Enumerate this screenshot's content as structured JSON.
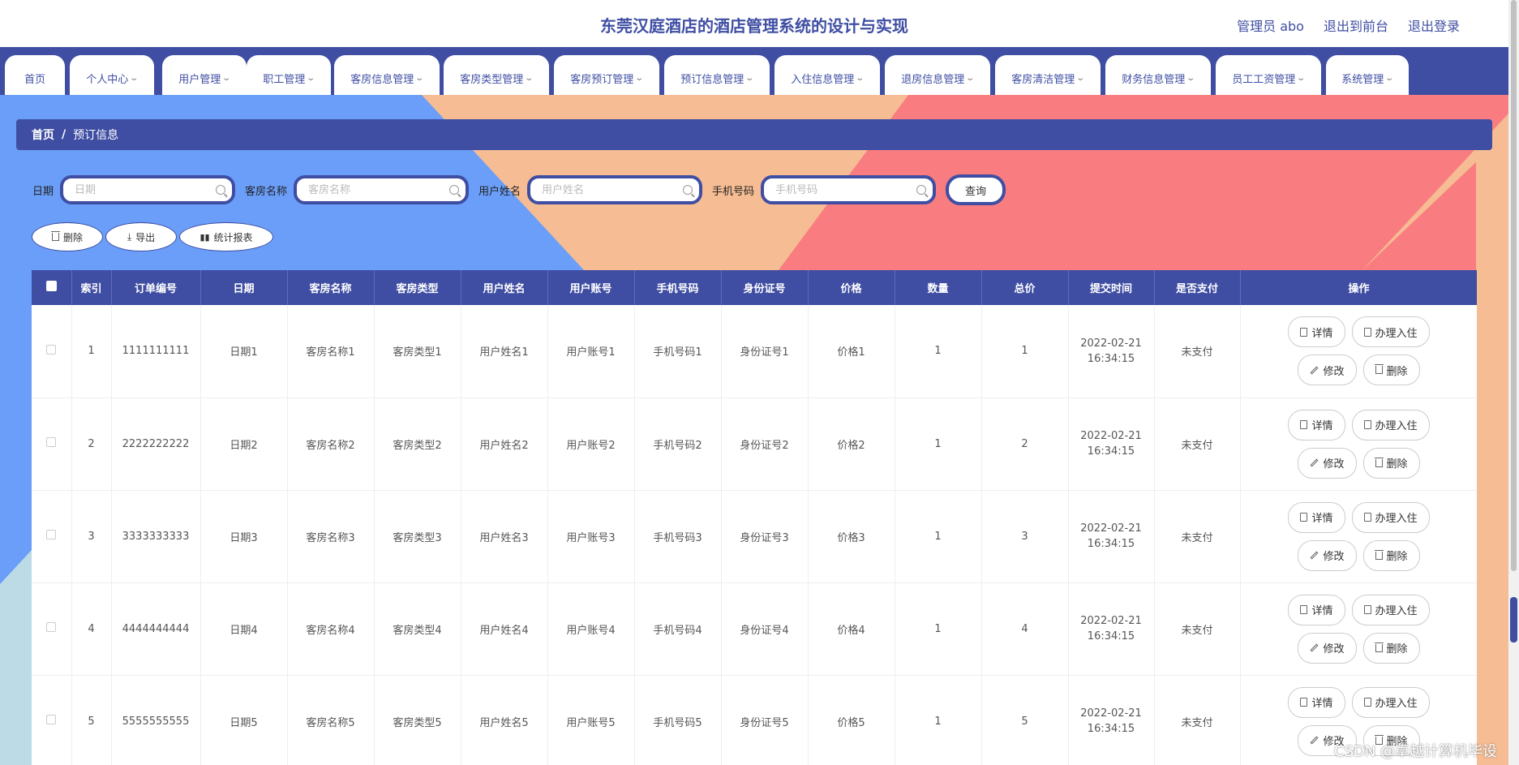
{
  "header": {
    "title": "东莞汉庭酒店的酒店管理系统的设计与实现",
    "admin_label": "管理员 abo",
    "to_front_label": "退出到前台",
    "logout_label": "退出登录"
  },
  "nav": {
    "items": [
      {
        "label": "首页",
        "has_dropdown": false
      },
      {
        "label": "个人中心",
        "has_dropdown": true
      },
      {
        "label": "用户管理",
        "has_dropdown": true
      },
      {
        "label": "职工管理",
        "has_dropdown": true
      },
      {
        "label": "客房信息管理",
        "has_dropdown": true
      },
      {
        "label": "客房类型管理",
        "has_dropdown": true
      },
      {
        "label": "客房预订管理",
        "has_dropdown": true
      },
      {
        "label": "预订信息管理",
        "has_dropdown": true
      },
      {
        "label": "入住信息管理",
        "has_dropdown": true
      },
      {
        "label": "退房信息管理",
        "has_dropdown": true
      },
      {
        "label": "客房清洁管理",
        "has_dropdown": true
      },
      {
        "label": "财务信息管理",
        "has_dropdown": true
      },
      {
        "label": "员工工资管理",
        "has_dropdown": true
      },
      {
        "label": "系统管理",
        "has_dropdown": true
      }
    ]
  },
  "breadcrumb": {
    "home": "首页",
    "separator": "/",
    "current": "预订信息"
  },
  "search": {
    "date_label": "日期",
    "date_placeholder": "日期",
    "room_name_label": "客房名称",
    "room_name_placeholder": "客房名称",
    "user_name_label": "用户姓名",
    "user_name_placeholder": "用户姓名",
    "phone_label": "手机号码",
    "phone_placeholder": "手机号码",
    "query_label": "查询"
  },
  "actions": {
    "delete_label": "删除",
    "export_label": "导出",
    "report_label": "统计报表"
  },
  "table": {
    "columns": [
      "索引",
      "订单编号",
      "日期",
      "客房名称",
      "客房类型",
      "用户姓名",
      "用户账号",
      "手机号码",
      "身份证号",
      "价格",
      "数量",
      "总价",
      "提交时间",
      "是否支付",
      "操作"
    ],
    "rows": [
      {
        "index": "1",
        "order_no": "1111111111",
        "date": "日期1",
        "room_name": "客房名称1",
        "room_type": "客房类型1",
        "user_name": "用户姓名1",
        "user_account": "用户账号1",
        "phone": "手机号码1",
        "id_no": "身份证号1",
        "price": "价格1",
        "qty": "1",
        "total": "1",
        "submit_date": "2022-02-21",
        "submit_time": "16:34:15",
        "paid": "未支付"
      },
      {
        "index": "2",
        "order_no": "2222222222",
        "date": "日期2",
        "room_name": "客房名称2",
        "room_type": "客房类型2",
        "user_name": "用户姓名2",
        "user_account": "用户账号2",
        "phone": "手机号码2",
        "id_no": "身份证号2",
        "price": "价格2",
        "qty": "1",
        "total": "2",
        "submit_date": "2022-02-21",
        "submit_time": "16:34:15",
        "paid": "未支付"
      },
      {
        "index": "3",
        "order_no": "3333333333",
        "date": "日期3",
        "room_name": "客房名称3",
        "room_type": "客房类型3",
        "user_name": "用户姓名3",
        "user_account": "用户账号3",
        "phone": "手机号码3",
        "id_no": "身份证号3",
        "price": "价格3",
        "qty": "1",
        "total": "3",
        "submit_date": "2022-02-21",
        "submit_time": "16:34:15",
        "paid": "未支付"
      },
      {
        "index": "4",
        "order_no": "4444444444",
        "date": "日期4",
        "room_name": "客房名称4",
        "room_type": "客房类型4",
        "user_name": "用户姓名4",
        "user_account": "用户账号4",
        "phone": "手机号码4",
        "id_no": "身份证号4",
        "price": "价格4",
        "qty": "1",
        "total": "4",
        "submit_date": "2022-02-21",
        "submit_time": "16:34:15",
        "paid": "未支付"
      },
      {
        "index": "5",
        "order_no": "5555555555",
        "date": "日期5",
        "room_name": "客房名称5",
        "room_type": "客房类型5",
        "user_name": "用户姓名5",
        "user_account": "用户账号5",
        "phone": "手机号码5",
        "id_no": "身份证号5",
        "price": "价格5",
        "qty": "1",
        "total": "5",
        "submit_date": "2022-02-21",
        "submit_time": "16:34:15",
        "paid": "未支付"
      }
    ],
    "row_actions": {
      "detail_label": "详情",
      "checkin_label": "办理入住",
      "edit_label": "修改",
      "delete_label": "删除"
    }
  },
  "watermark": "CSDN @卓越计算机毕设",
  "colors": {
    "primary": "#3f4ea3",
    "bg_blue": "#6a9ef8",
    "bg_peach": "#f6bc93",
    "bg_coral": "#f97d80",
    "bg_light": "#bcdbe6"
  }
}
